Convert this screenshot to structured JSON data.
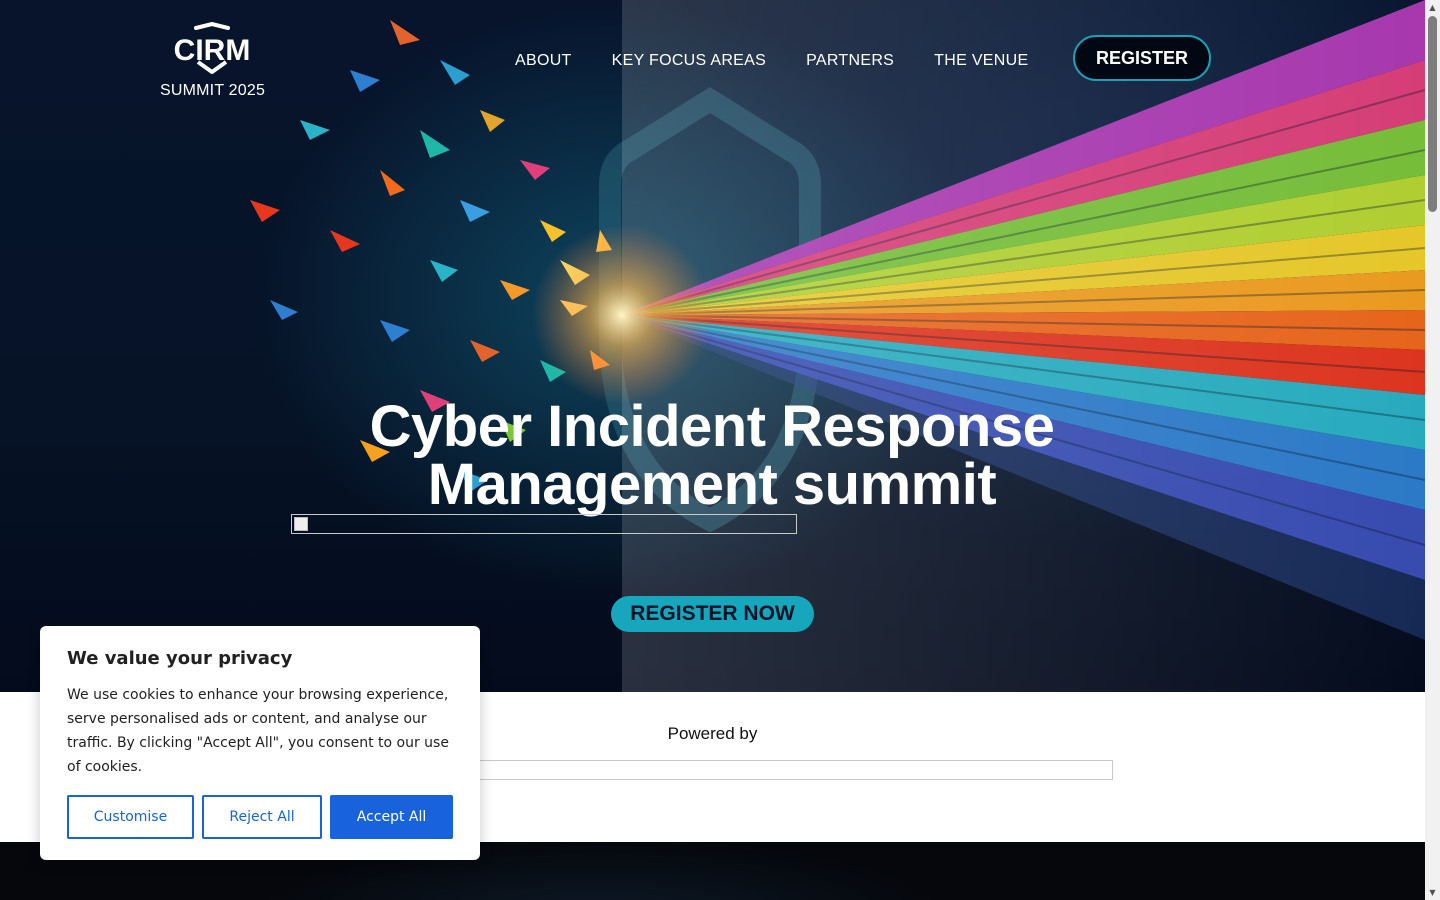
{
  "logo": {
    "wordmark": "CIRM",
    "subtitle": "SUMMIT 2025"
  },
  "nav": {
    "items": [
      "ABOUT",
      "KEY FOCUS AREAS",
      "PARTNERS",
      "THE VENUE"
    ]
  },
  "header": {
    "register_label": "REGISTER"
  },
  "hero": {
    "title_line1": "Cyber Incident Response",
    "title_line2": "Management summit",
    "cta_label": "REGISTER NOW"
  },
  "powered": {
    "label": "Powered by"
  },
  "cookie": {
    "title": "We value your privacy",
    "text": "We use cookies to enhance your browsing experience, serve personalised ads or content, and analyse our traffic. By clicking \"Accept All\", you consent to our use of cookies.",
    "customise_label": "Customise",
    "reject_label": "Reject All",
    "accept_label": "Accept All"
  },
  "colors": {
    "accent": "#17a7bd",
    "hero_bg": "#061327",
    "cookie_primary": "#1863dc"
  }
}
